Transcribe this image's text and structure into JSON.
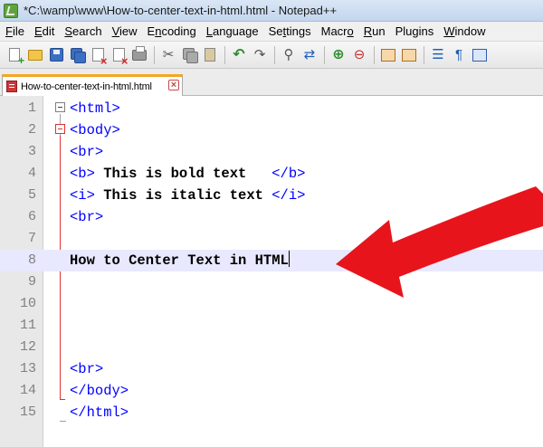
{
  "window": {
    "title": "*C:\\wamp\\www\\How-to-center-text-in-html.html - Notepad++"
  },
  "menu": [
    {
      "pre": "",
      "ul": "F",
      "post": "ile"
    },
    {
      "pre": "",
      "ul": "E",
      "post": "dit"
    },
    {
      "pre": "",
      "ul": "S",
      "post": "earch"
    },
    {
      "pre": "",
      "ul": "V",
      "post": "iew"
    },
    {
      "pre": "E",
      "ul": "n",
      "post": "coding"
    },
    {
      "pre": "",
      "ul": "L",
      "post": "anguage"
    },
    {
      "pre": "Se",
      "ul": "t",
      "post": "tings"
    },
    {
      "pre": "Macr",
      "ul": "o",
      "post": ""
    },
    {
      "pre": "",
      "ul": "R",
      "post": "un"
    },
    {
      "pre": "Plugins",
      "ul": "",
      "post": ""
    },
    {
      "pre": "",
      "ul": "W",
      "post": "indow"
    }
  ],
  "toolbar_icons": [
    "new-file-icon",
    "open-folder-icon",
    "save-icon",
    "save-all-icon",
    "close-file-icon",
    "close-all-icon",
    "print-icon",
    "cut-icon",
    "copy-icon",
    "paste-icon",
    "undo-icon",
    "redo-icon",
    "find-icon",
    "replace-icon",
    "zoom-in-icon",
    "zoom-out-icon",
    "sync-v-icon",
    "sync-h-icon",
    "word-wrap-icon",
    "show-all-chars-icon",
    "indent-guide-icon"
  ],
  "tab": {
    "label": "How-to-center-text-in-html.html",
    "close_glyph": "×"
  },
  "editor": {
    "current_line": 8,
    "lines": [
      {
        "num": "1",
        "tag_open": "<html>",
        "text": "",
        "tag_close": ""
      },
      {
        "num": "2",
        "tag_open": "<body>",
        "text": "",
        "tag_close": ""
      },
      {
        "num": "3",
        "tag_open": "<br>",
        "text": "",
        "tag_close": ""
      },
      {
        "num": "4",
        "tag_open": "<b>",
        "text": " This is bold text   ",
        "tag_close": "</b>"
      },
      {
        "num": "5",
        "tag_open": "<i>",
        "text": " This is italic text ",
        "tag_close": "</i>"
      },
      {
        "num": "6",
        "tag_open": "<br>",
        "text": "",
        "tag_close": ""
      },
      {
        "num": "7",
        "tag_open": "",
        "text": "",
        "tag_close": ""
      },
      {
        "num": "8",
        "tag_open": "",
        "text": "How to Center Text in HTML",
        "tag_close": ""
      },
      {
        "num": "9",
        "tag_open": "",
        "text": "",
        "tag_close": ""
      },
      {
        "num": "10",
        "tag_open": "",
        "text": "",
        "tag_close": ""
      },
      {
        "num": "11",
        "tag_open": "",
        "text": "",
        "tag_close": ""
      },
      {
        "num": "12",
        "tag_open": "",
        "text": "",
        "tag_close": ""
      },
      {
        "num": "13",
        "tag_open": "<br>",
        "text": "",
        "tag_close": ""
      },
      {
        "num": "14",
        "tag_open": "</body>",
        "text": "",
        "tag_close": ""
      },
      {
        "num": "15",
        "tag_open": "</html>",
        "text": "",
        "tag_close": ""
      }
    ]
  },
  "annotation": {
    "arrow_color": "#e8141c",
    "points_to_line": 8
  },
  "colors": {
    "tag": "#0000ff",
    "text": "#000000",
    "line_number": "#808080",
    "current_line_bg": "#e8e8ff",
    "tab_accent": "#f5a623"
  }
}
